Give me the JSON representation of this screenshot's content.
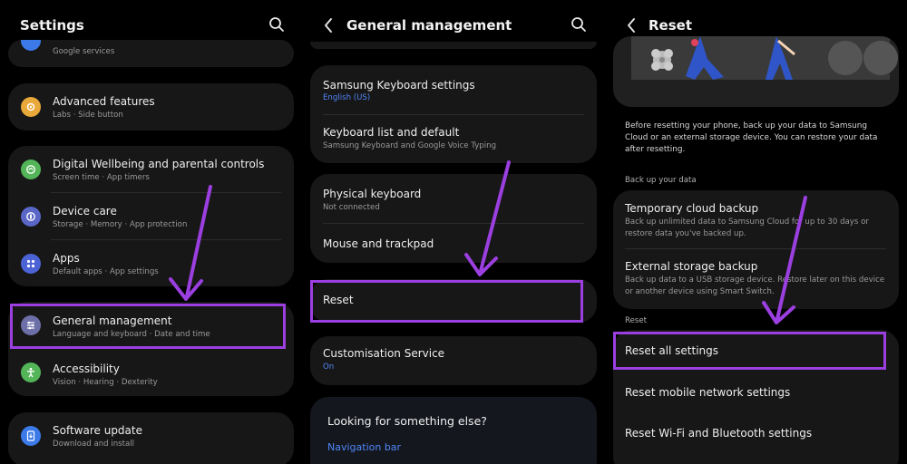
{
  "panel1": {
    "title": "Settings",
    "items": [
      {
        "sub": "Google services"
      },
      {
        "title": "Advanced features",
        "sub": "Labs  ·  Side button"
      },
      {
        "title": "Digital Wellbeing and parental controls",
        "sub": "Screen time  ·  App timers"
      },
      {
        "title": "Device care",
        "sub": "Storage  ·  Memory  ·  App protection"
      },
      {
        "title": "Apps",
        "sub": "Default apps  ·  App settings"
      },
      {
        "title": "General management",
        "sub": "Language and keyboard  ·  Date and time"
      },
      {
        "title": "Accessibility",
        "sub": "Vision  ·  Hearing  ·  Dexterity"
      },
      {
        "title": "Software update",
        "sub": "Download and install"
      }
    ]
  },
  "panel2": {
    "title": "General management",
    "items": [
      {
        "title": "Samsung Keyboard settings",
        "sub": "English (US)"
      },
      {
        "title": "Keyboard list and default",
        "sub": "Samsung Keyboard and Google Voice Typing"
      },
      {
        "title": "Physical keyboard",
        "sub": "Not connected"
      },
      {
        "title": "Mouse and trackpad"
      },
      {
        "title": "Reset"
      },
      {
        "title": "Customisation Service",
        "sub": "On"
      }
    ],
    "looking": {
      "title": "Looking for something else?",
      "link": "Navigation bar"
    }
  },
  "panel3": {
    "title": "Reset",
    "intro": "Before resetting your phone, back up your data to Samsung Cloud or an external storage device. You can restore your data after resetting.",
    "backup_header": "Back up your data",
    "backup_items": [
      {
        "title": "Temporary cloud backup",
        "desc": "Back up unlimited data to Samsung Cloud for up to 30 days or restore data you've backed up."
      },
      {
        "title": "External storage backup",
        "desc": "Back up data to a USB storage device. Restore later on this device or another device using Smart Switch."
      }
    ],
    "reset_header": "Reset",
    "reset_items": [
      {
        "title": "Reset all settings"
      },
      {
        "title": "Reset mobile network settings"
      },
      {
        "title": "Reset Wi-Fi and Bluetooth settings"
      }
    ]
  },
  "colors": {
    "highlight": "#9b3fe0",
    "arrow": "#9b3fe0",
    "link_blue": "#4f86f7",
    "card_bg": "#171717"
  },
  "icons": [
    "search-icon",
    "back-icon",
    "star-gear-icon",
    "wellbeing-icon",
    "device-care-icon",
    "apps-icon",
    "sliders-icon",
    "accessibility-icon",
    "software-update-icon"
  ]
}
